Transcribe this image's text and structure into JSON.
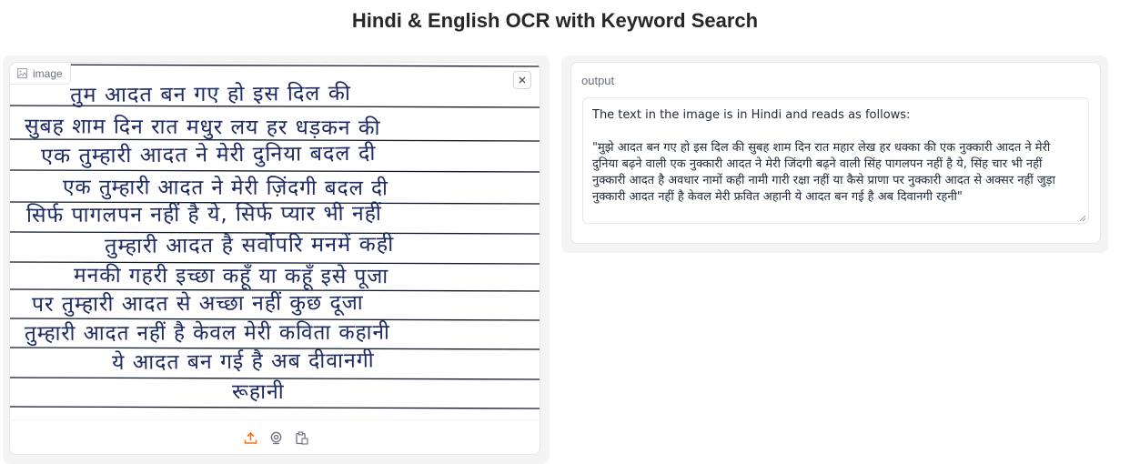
{
  "app": {
    "title": "Hindi & English OCR with Keyword Search"
  },
  "image_panel": {
    "label": "image",
    "handwritten_lines": [
      "तुम आदत बन गए हो इस दिल की",
      "सुबह शाम दिन रात मधुर लय हर धड़कन की",
      "एक तुम्हारी आदत ने मेरी दुनिया बदल दी",
      "एक तुम्हारी आदत ने मेरी ज़िंदगी बदल दी",
      "सिर्फ पागलपन नहीं है ये, सिर्फ प्यार भी नहीं",
      "तुम्हारी आदत है सर्वोपरि मनमें कही",
      "मनकी गहरी इच्छा कहूँ या कहूँ इसे पूजा",
      "पर तुम्हारी आदत से अच्छा नहीं कुछ दूजा",
      "तुम्हारी आदत नहीं है केवल मेरी कविता कहानी",
      "ये आदत बन गई है अब दीवानगी",
      "रूहानी"
    ],
    "icons": {
      "label_icon": "image-icon",
      "close": "close-icon",
      "upload": "upload-icon",
      "webcam": "webcam-icon",
      "clipboard": "clipboard-icon"
    },
    "accent_color": "#f97316"
  },
  "output_panel": {
    "label": "output",
    "value": "The text in the image is in Hindi and reads as follows:\n\n\"मुझे आदत बन गए हो इस दिल की सुबह शाम दिन रात महार लेख हर धक्का की एक नुक्कारी आदत ने मेरी दुनिया बढ़ने वाली एक नुक्कारी आदत ने मेरी जिंदगी बढ़ने वाली सिंह पागलपन नहीं है ये, सिंह चार भी नहीं नुक्कारी आदत है अवधार नामों कही नामी गारी रक्षा नहीं या कैसे प्राणा पर नुक्कारी आदत से अक्सर नहीं जुड़ा नुक्कारी आदत नहीं है केवल मेरी फ्रवित अहानी ये आदत बन गई है अब दिवानगी रहनी\""
  }
}
